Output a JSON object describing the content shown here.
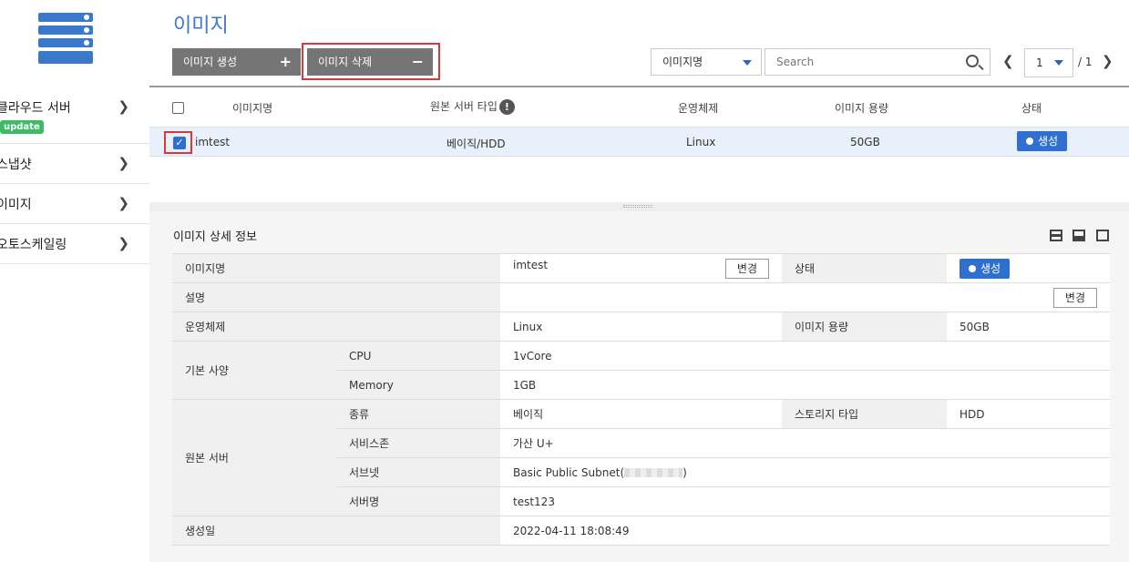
{
  "sidebar": {
    "logo_icon": "server-stack-icon",
    "items": [
      {
        "label": "클라우드 서버",
        "badge": "update"
      },
      {
        "label": "스냅샷"
      },
      {
        "label": "이미지"
      },
      {
        "label": "오토스케일링"
      }
    ]
  },
  "header": {
    "title": "이미지",
    "create_label": "이미지 생성",
    "delete_label": "이미지 삭제",
    "filter_selected": "이미지명",
    "search_placeholder": "Search",
    "page_current": "1",
    "page_total": "/ 1"
  },
  "list": {
    "columns": [
      "이미지명",
      "원본 서버 타입",
      "운영체제",
      "이미지 용량",
      "상태"
    ],
    "rows": [
      {
        "name": "imtest",
        "server_type": "베이직/HDD",
        "os": "Linux",
        "size": "50GB",
        "status": "생성",
        "checked": true
      }
    ]
  },
  "detail": {
    "title": "이미지 상세 정보",
    "labels": {
      "name": "이미지명",
      "status": "상태",
      "desc": "설명",
      "os": "운영체제",
      "size": "이미지 용량",
      "spec": "기본 사양",
      "cpu": "CPU",
      "memory": "Memory",
      "origin": "원본 서버",
      "kind": "종류",
      "storage_type": "스토리지 타입",
      "zone": "서비스존",
      "subnet": "서브넷",
      "server_name": "서버명",
      "created": "생성일"
    },
    "values": {
      "name": "imtest",
      "status": "생성",
      "desc": "",
      "os": "Linux",
      "size": "50GB",
      "cpu": "1vCore",
      "memory": "1GB",
      "kind": "베이직",
      "storage_type": "HDD",
      "zone": "가산 U+",
      "subnet_prefix": "Basic Public Subnet(",
      "subnet_suffix": ")",
      "server_name": "test123",
      "created": "2022-04-11 18:08:49"
    },
    "change_label": "변경"
  },
  "colors": {
    "accent": "#3a78c9",
    "status": "#2f6fd0",
    "highlight": "#d9383a",
    "badge": "#3dbb67"
  }
}
